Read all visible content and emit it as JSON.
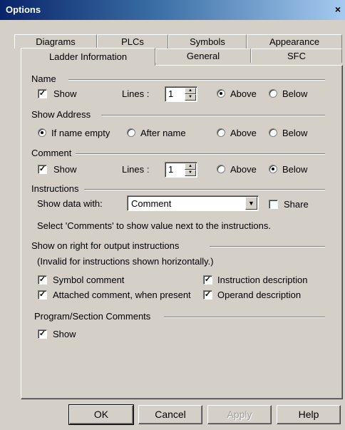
{
  "window": {
    "title": "Options",
    "close_glyph": "×"
  },
  "tabs": {
    "back_row": [
      "Diagrams",
      "PLCs",
      "Symbols",
      "Appearance"
    ],
    "front_row": [
      "Ladder Information",
      "General",
      "SFC"
    ],
    "active": "Ladder Information"
  },
  "name_group": {
    "title": "Name",
    "show_label": "Show",
    "show_checked": true,
    "lines_label": "Lines :",
    "lines_value": "1",
    "above_label": "Above",
    "below_label": "Below",
    "selected": "Above"
  },
  "address_group": {
    "title": "Show Address",
    "if_name_empty_label": "If name empty",
    "after_name_label": "After name",
    "above_label": "Above",
    "below_label": "Below",
    "selected": [
      "If name empty"
    ]
  },
  "comment_group": {
    "title": "Comment",
    "show_label": "Show",
    "show_checked": true,
    "lines_label": "Lines :",
    "lines_value": "1",
    "above_label": "Above",
    "below_label": "Below",
    "selected": "Below"
  },
  "instructions_group": {
    "title": "Instructions",
    "show_data_label": "Show data with:",
    "combo_value": "Comment",
    "share_label": "Share",
    "share_checked": false,
    "hint": "Select 'Comments' to show value next to the instructions."
  },
  "output_group": {
    "title": "Show on right for output instructions",
    "note": "(Invalid for instructions shown horizontally.)",
    "symbol_comment_label": "Symbol comment",
    "symbol_comment_checked": true,
    "attached_comment_label": "Attached comment, when present",
    "attached_comment_checked": true,
    "instruction_desc_label": "Instruction description",
    "instruction_desc_checked": true,
    "operand_desc_label": "Operand description",
    "operand_desc_checked": true
  },
  "program_group": {
    "title": "Program/Section Comments",
    "show_label": "Show",
    "show_checked": true
  },
  "buttons": {
    "ok": "OK",
    "cancel": "Cancel",
    "apply": "Apply",
    "help": "Help"
  },
  "glyphs": {
    "check": "✓",
    "spin_up": "▲",
    "spin_down": "▼",
    "dropdown": "▼"
  }
}
